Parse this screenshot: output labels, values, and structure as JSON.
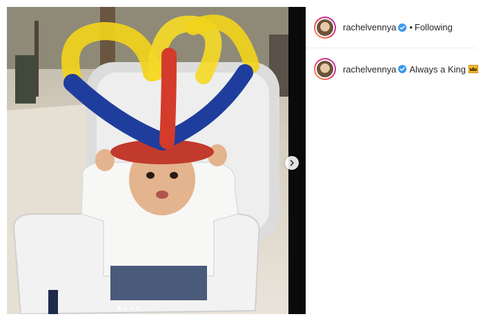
{
  "header": {
    "username": "rachelvennya",
    "separator": "•",
    "follow_status": "Following"
  },
  "caption": {
    "username": "rachelvennya",
    "text": "Always a King",
    "emoji_icon": "crown-icon"
  },
  "media": {
    "carousel_dots": 4,
    "active_index": 0
  },
  "colors": {
    "verified_blue": "#3897f0",
    "text": "#262626",
    "crown_gold": "#e8a317"
  }
}
